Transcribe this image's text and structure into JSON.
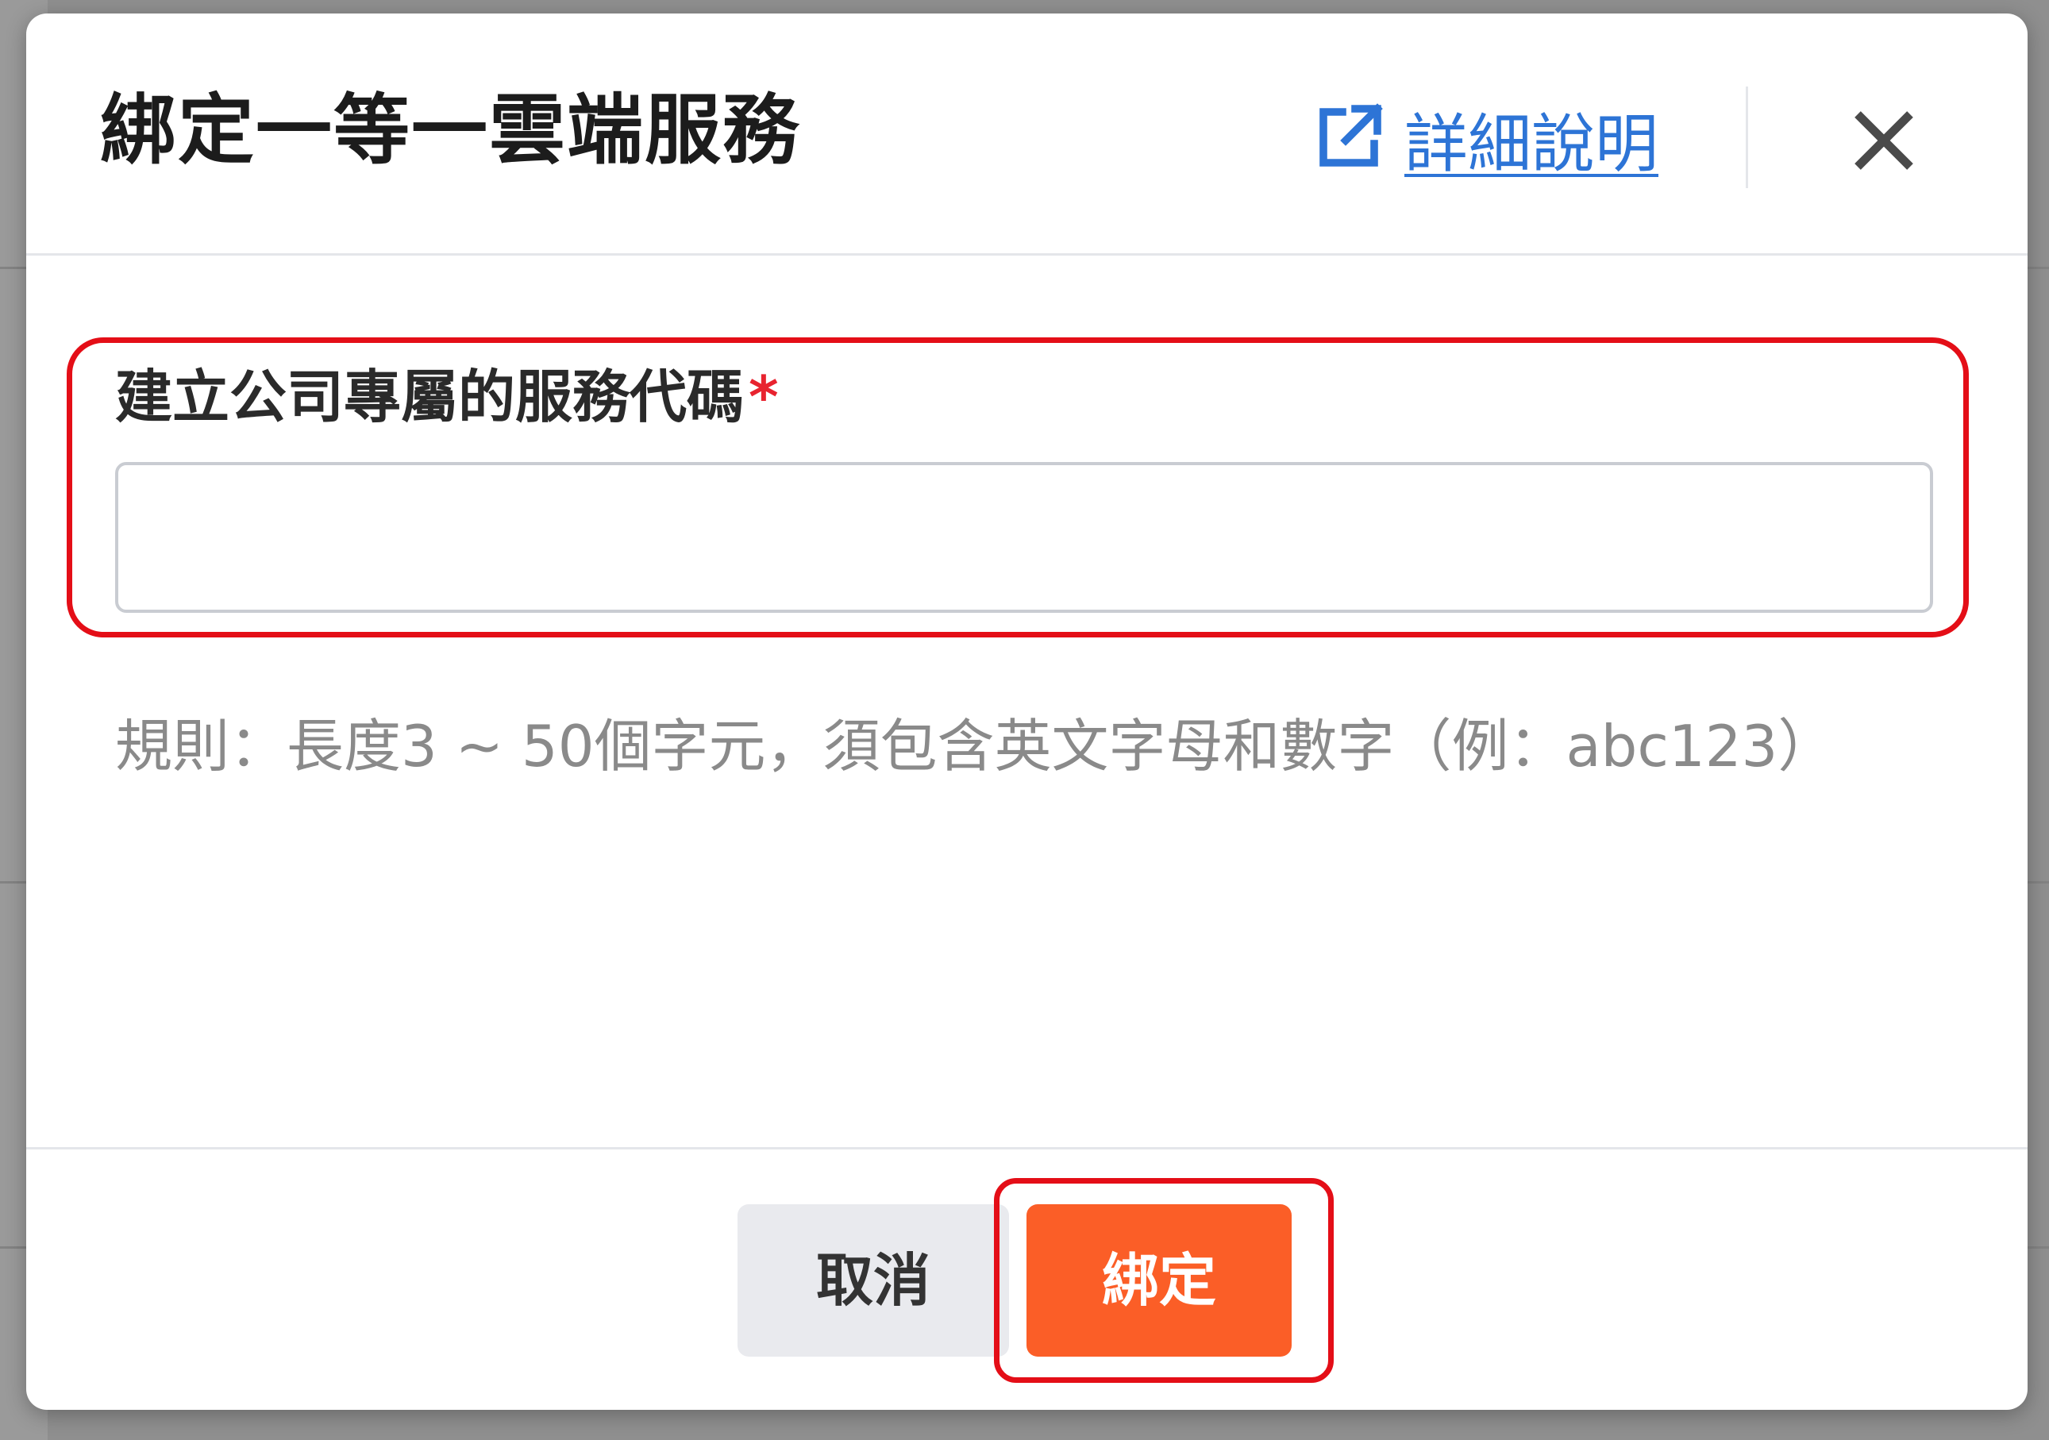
{
  "dialog": {
    "title": "綁定一等一雲端服務",
    "help_link": {
      "label": "詳細說明",
      "icon": "external-link-icon",
      "color": "#2d74d6"
    },
    "close_icon": "close-icon"
  },
  "form": {
    "field_label": "建立公司專屬的服務代碼",
    "required_mark": "*",
    "input_value": "",
    "hint": "規則：長度3 ~ 50個字元，須包含英文字母和數字（例：abc123）"
  },
  "footer": {
    "cancel_label": "取消",
    "bind_label": "綁定"
  },
  "colors": {
    "primary_button": "#fb5e27",
    "highlight_border": "#e40e17",
    "required": "#e8232f"
  }
}
